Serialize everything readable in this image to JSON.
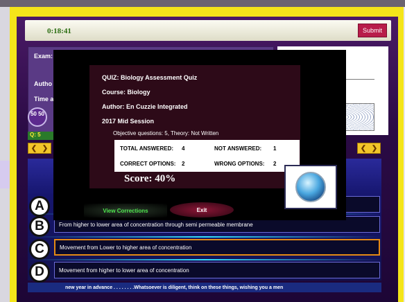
{
  "timer": "0:18:41",
  "submit_label": "Submit",
  "panel": {
    "exam_label": "Exam:",
    "author_label": "Autho",
    "time_label": "Time a",
    "fifty_fifty": "50 50",
    "question_number": "Q: 5"
  },
  "options": [
    {
      "letter": "A",
      "text": ""
    },
    {
      "letter": "B",
      "text": "From higher to lower area of concentration through semi permeable membrane"
    },
    {
      "letter": "C",
      "text": "Movement from Lower to higher area of concentration"
    },
    {
      "letter": "D",
      "text": "Movement from higher to lower area of concentration"
    }
  ],
  "ticker": "new year in advance . . . . . . .   .Whatsoever is diligent, think on these things, wishing you a men",
  "result": {
    "quiz": "QUIZ: Biology Assessment Quiz",
    "course": "Course: Biology",
    "author": "Author: En Cuzzie Integrated",
    "session": "2017 Mid Session",
    "objective_line": "Objective questions: 5, Theory: Not Written",
    "total_answered_label": "TOTAL ANSWERED:",
    "total_answered": "4",
    "not_answered_label": "NOT ANSWERED:",
    "not_answered": "1",
    "correct_label": "CORRECT OPTIONS:",
    "correct": "2",
    "wrong_label": "WRONG OPTIONS:",
    "wrong": "2",
    "score": "Score:  40%",
    "view_corrections": "View Corrections",
    "exit": "Exit"
  },
  "colors": {
    "frame": "#f4e51a",
    "submit": "#b81d4a",
    "timer_text": "#2a6d10",
    "view_corrections_text": "#4ee44e"
  }
}
